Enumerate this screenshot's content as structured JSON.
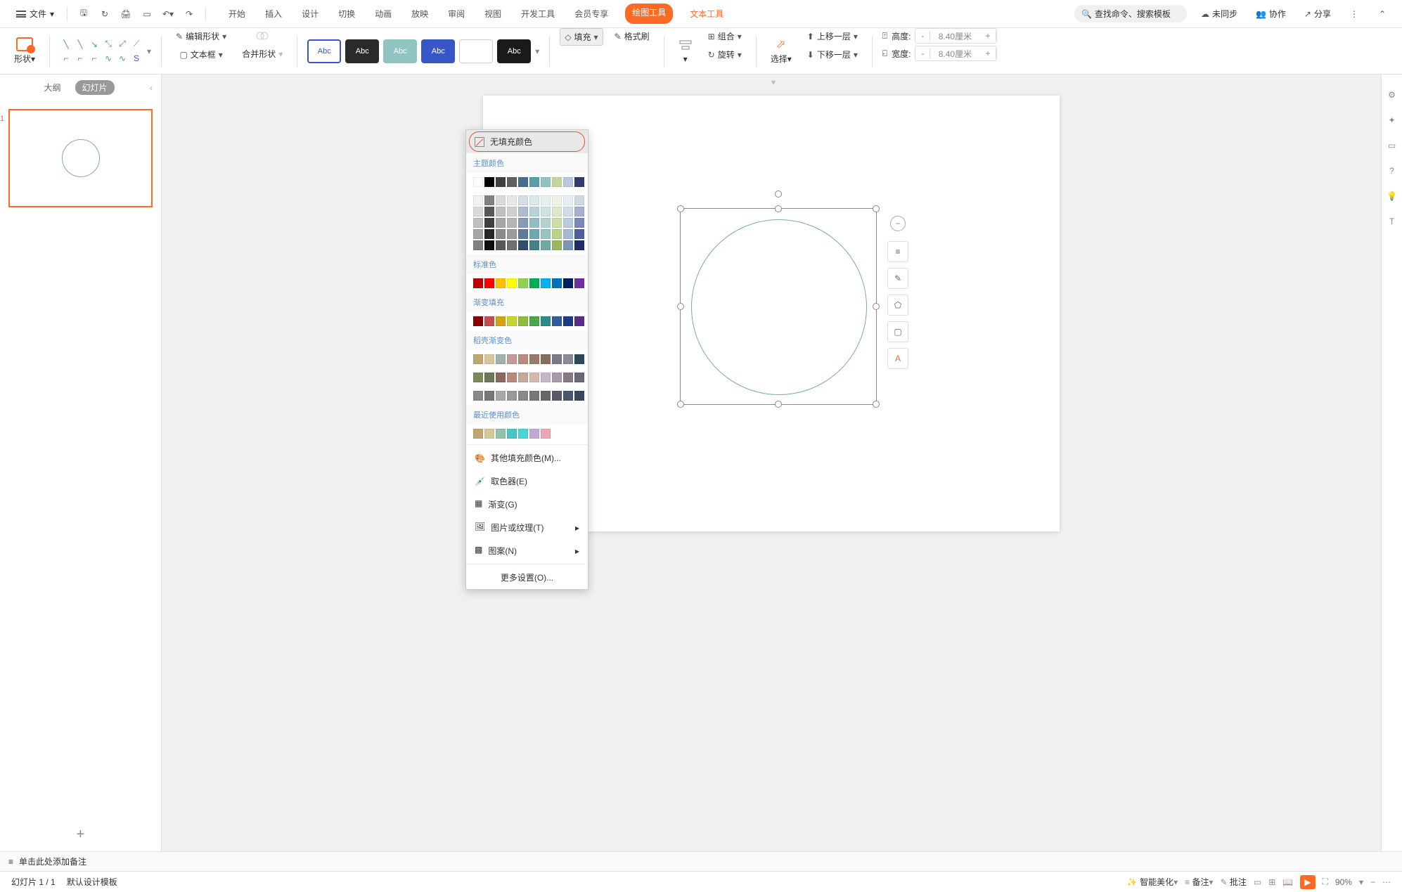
{
  "menubar": {
    "file": "文件",
    "tabs": [
      "开始",
      "插入",
      "设计",
      "切换",
      "动画",
      "放映",
      "审阅",
      "视图",
      "开发工具",
      "会员专享"
    ],
    "draw_tool": "绘图工具",
    "text_tool": "文本工具",
    "search_placeholder": "查找命令、搜索模板",
    "unsync": "未同步",
    "collab": "协作",
    "share": "分享"
  },
  "ribbon": {
    "shape": "形状",
    "edit_shape": "编辑形状",
    "textbox": "文本框",
    "merge_shape": "合并形状",
    "abc": "Abc",
    "fill": "填充",
    "format_painter": "格式刷",
    "group": "组合",
    "rotate": "旋转",
    "select": "选择",
    "move_up": "上移一层",
    "move_down": "下移一层",
    "height": "高度:",
    "width": "宽度:",
    "h_val": "8.40厘米",
    "w_val": "8.40厘米",
    "minus": "-",
    "plus": "+"
  },
  "sidebar": {
    "outline": "大纲",
    "slides": "幻灯片",
    "num": "1"
  },
  "dropdown": {
    "no_fill": "无填充颜色",
    "theme_colors": "主题颜色",
    "standard_colors": "标准色",
    "gradient_fill": "渐变填充",
    "dao_gradient": "稻壳渐变色",
    "recent_colors": "最近使用颜色",
    "more_fill": "其他填充颜色(M)...",
    "eyedropper": "取色器(E)",
    "gradient": "渐变(G)",
    "picture": "图片或纹理(T)",
    "pattern": "图案(N)",
    "more_settings": "更多设置(O)...",
    "theme_grid": [
      "#ffffff",
      "#000000",
      "#404040",
      "#5f5f5f",
      "#4a6d8c",
      "#5a9fa8",
      "#8fc4c1",
      "#c4d79b",
      "#b8c8d9",
      "#2e3d6b"
    ],
    "theme_shades": [
      [
        "#f2f2f2",
        "#808080",
        "#d9d9d9",
        "#e8e8e8",
        "#d5dde6",
        "#dbe9eb",
        "#e5f0ef",
        "#eef4e2",
        "#e8eef4",
        "#d2d7e6"
      ],
      [
        "#d9d9d9",
        "#595959",
        "#bfbfbf",
        "#cfcfcf",
        "#adbcce",
        "#b8d4d8",
        "#ccE2e0",
        "#dde9c6",
        "#d2dcea",
        "#a6afcc"
      ],
      [
        "#bfbfbf",
        "#404040",
        "#a6a6a6",
        "#b5b5b5",
        "#859bb6",
        "#94bec4",
        "#b2d3d0",
        "#cbdda9",
        "#bbcadf",
        "#7a87b3"
      ],
      [
        "#a6a6a6",
        "#262626",
        "#8c8c8c",
        "#9c9c9c",
        "#5d7a9e",
        "#71a9b1",
        "#98c5c1",
        "#bad28d",
        "#a5b8d5",
        "#4d5e99"
      ],
      [
        "#808080",
        "#0d0d0d",
        "#595959",
        "#6f6f6f",
        "#324c6f",
        "#478089",
        "#6fa9a4",
        "#97b85f",
        "#7d94bd",
        "#1f2e66"
      ]
    ],
    "standard": [
      "#c00000",
      "#ff0000",
      "#ffc000",
      "#ffff00",
      "#92d050",
      "#00b050",
      "#00b0f0",
      "#0070c0",
      "#002060",
      "#7030a0"
    ],
    "gradient_row": [
      "#8b0000",
      "#c0504d",
      "#d4a017",
      "#c4d631",
      "#8fbc3f",
      "#4ca64c",
      "#2e8b8b",
      "#2e5e9e",
      "#1e3a8a",
      "#5b2c8a"
    ],
    "dao1": [
      "#bfa76f",
      "#d4c898",
      "#9bb5a8",
      "#c49a9a",
      "#b88c7a",
      "#9a7a6a",
      "#8a6f5a",
      "#7a7a8a",
      "#8a8a9a",
      "#2a4a5a"
    ],
    "dao2": [
      "#7a8a5a",
      "#6a7a5a",
      "#8a6a5a",
      "#b88a7a",
      "#c4a898",
      "#d4b8a8",
      "#c4b8c8",
      "#a898a8",
      "#887888",
      "#686878"
    ],
    "dao3": [
      "#888888",
      "#787878",
      "#a8a8a8",
      "#989898",
      "#888888",
      "#787878",
      "#686868",
      "#585868",
      "#485868",
      "#384858"
    ],
    "recent": [
      "#bfa76f",
      "#d4c898",
      "#8fc4a8",
      "#4ac4c4",
      "#4ad4d4",
      "#c4a8d4",
      "#e8a8b8"
    ]
  },
  "notes": "单击此处添加备注",
  "status": {
    "slide_count": "幻灯片 1 / 1",
    "template": "默认设计模板",
    "beautify": "智能美化",
    "notes": "备注",
    "comment": "批注",
    "zoom": "90%"
  }
}
